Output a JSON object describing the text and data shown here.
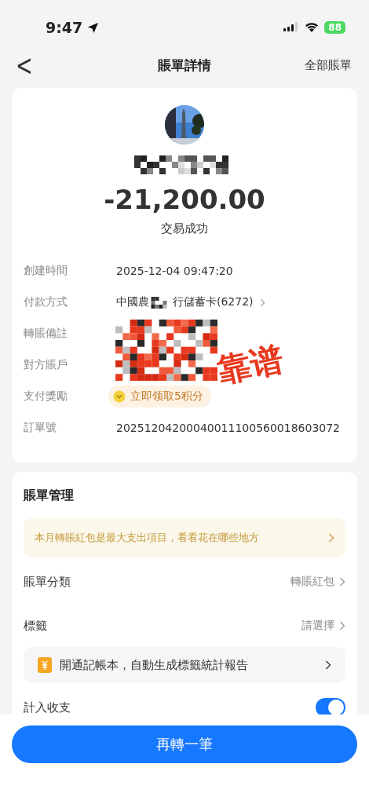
{
  "status_bar": {
    "time": "9:47",
    "battery": "88"
  },
  "nav": {
    "back": "<",
    "title": "賬單詳情",
    "action": "全部賬單"
  },
  "summary": {
    "amount": "-21,200.00",
    "status": "交易成功",
    "name_redacted": true
  },
  "details": [
    {
      "kind": "text",
      "label": "創建時間",
      "value": "2025-12-04 09:47:20"
    },
    {
      "kind": "link",
      "label": "付款方式",
      "value_before": "中國農",
      "value_after": "行儲蓄卡(6272)",
      "redacted": true
    },
    {
      "kind": "redacted",
      "label": "轉賬備註"
    },
    {
      "kind": "redacted",
      "label": "對方賬戶"
    },
    {
      "kind": "badge",
      "label": "支付獎勵",
      "value": "立即领取5积分"
    },
    {
      "kind": "text",
      "label": "訂單號",
      "value": "20251204200040011100560018603072"
    }
  ],
  "sticker": "靠谱",
  "management": {
    "title": "賬單管理",
    "insight": "本月轉賬紅包是最大支出項目，看看花在哪些地方",
    "rows": [
      {
        "kind": "select",
        "label": "賬單分類",
        "value": "轉賬紅包"
      },
      {
        "kind": "select",
        "label": "標籤",
        "value": "請選擇"
      },
      {
        "kind": "promo",
        "text": "開通記帳本，自動生成標籤統計報告"
      },
      {
        "kind": "toggle",
        "label": "計入收支",
        "on": true
      }
    ]
  },
  "footer": {
    "button": "再轉一筆"
  }
}
